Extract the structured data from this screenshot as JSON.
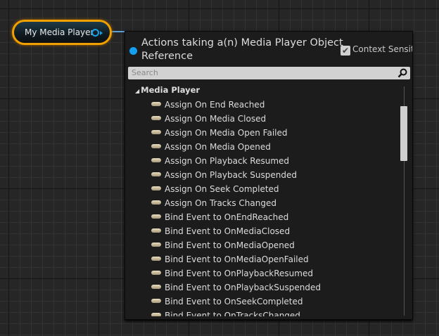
{
  "node": {
    "label": "My Media Player",
    "pin_color": "#18a0e8",
    "border_color": "#f0a000"
  },
  "menu": {
    "title": "Actions taking a(n) Media Player Object Reference",
    "context_sensitive_label": "Context Sensitive",
    "context_sensitive_checked": true,
    "search_placeholder": "Search",
    "category": "Media Player",
    "items": [
      "Assign On End Reached",
      "Assign On Media Closed",
      "Assign On Media Open Failed",
      "Assign On Media Opened",
      "Assign On Playback Resumed",
      "Assign On Playback Suspended",
      "Assign On Seek Completed",
      "Assign On Tracks Changed",
      "Bind Event to OnEndReached",
      "Bind Event to OnMediaClosed",
      "Bind Event to OnMediaOpened",
      "Bind Event to OnMediaOpenFailed",
      "Bind Event to OnPlaybackResumed",
      "Bind Event to OnPlaybackSuspended",
      "Bind Event to OnSeekCompleted",
      "Bind Event to OnTracksChanged"
    ]
  }
}
